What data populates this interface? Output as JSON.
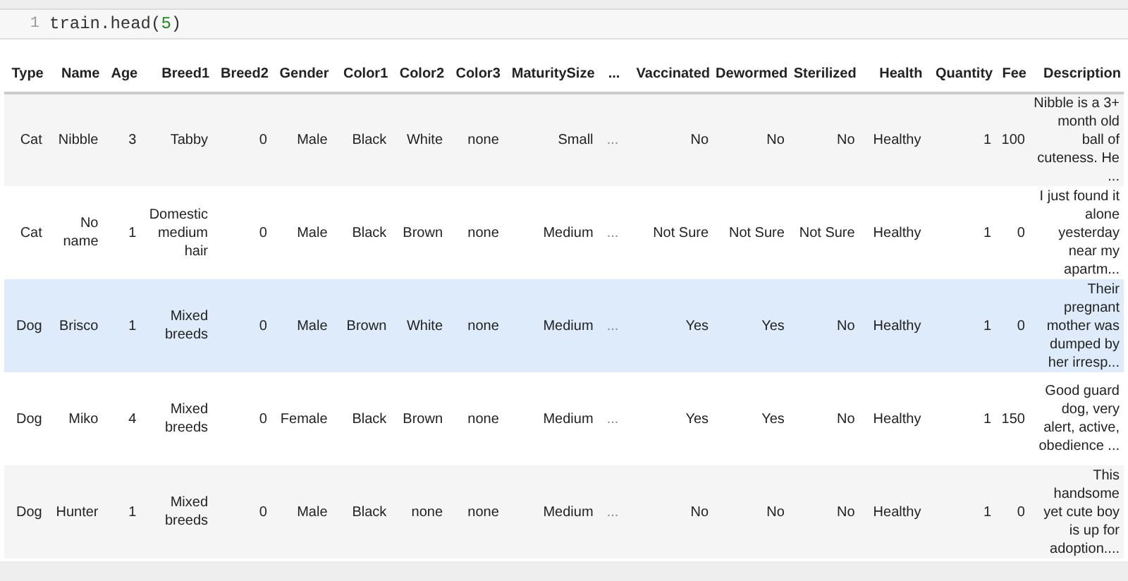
{
  "code_cell": {
    "line_number": "1",
    "tokens": [
      {
        "text": "train.head(",
        "kind": "plain"
      },
      {
        "text": "5",
        "kind": "number"
      },
      {
        "text": ")",
        "kind": "plain"
      }
    ]
  },
  "table": {
    "columns": [
      "Type",
      "Name",
      "Age",
      "Breed1",
      "Breed2",
      "Gender",
      "Color1",
      "Color2",
      "Color3",
      "MaturitySize",
      "...",
      "Vaccinated",
      "Dewormed",
      "Sterilized",
      "Health",
      "Quantity",
      "Fee",
      "Description"
    ],
    "rows": [
      {
        "highlighted": false,
        "cells": [
          "Cat",
          "Nibble",
          "3",
          "Tabby",
          "0",
          "Male",
          "Black",
          "White",
          "none",
          "Small",
          "...",
          "No",
          "No",
          "No",
          "Healthy",
          "1",
          "100",
          "Nibble is a 3+ month old ball of cuteness. He ..."
        ]
      },
      {
        "highlighted": false,
        "cells": [
          "Cat",
          "No name",
          "1",
          "Domestic medium hair",
          "0",
          "Male",
          "Black",
          "Brown",
          "none",
          "Medium",
          "...",
          "Not Sure",
          "Not Sure",
          "Not Sure",
          "Healthy",
          "1",
          "0",
          "I just found it alone yesterday near my apartm..."
        ]
      },
      {
        "highlighted": true,
        "cells": [
          "Dog",
          "Brisco",
          "1",
          "Mixed breeds",
          "0",
          "Male",
          "Brown",
          "White",
          "none",
          "Medium",
          "...",
          "Yes",
          "Yes",
          "No",
          "Healthy",
          "1",
          "0",
          "Their pregnant mother was dumped by her irresp..."
        ]
      },
      {
        "highlighted": false,
        "cells": [
          "Dog",
          "Miko",
          "4",
          "Mixed breeds",
          "0",
          "Female",
          "Black",
          "Brown",
          "none",
          "Medium",
          "...",
          "Yes",
          "Yes",
          "No",
          "Healthy",
          "1",
          "150",
          "Good guard dog, very alert, active, obedience ..."
        ]
      },
      {
        "highlighted": false,
        "cells": [
          "Dog",
          "Hunter",
          "1",
          "Mixed breeds",
          "0",
          "Male",
          "Black",
          "none",
          "none",
          "Medium",
          "...",
          "No",
          "No",
          "No",
          "Healthy",
          "1",
          "0",
          "This handsome yet cute boy is up for adoption...."
        ]
      }
    ]
  }
}
